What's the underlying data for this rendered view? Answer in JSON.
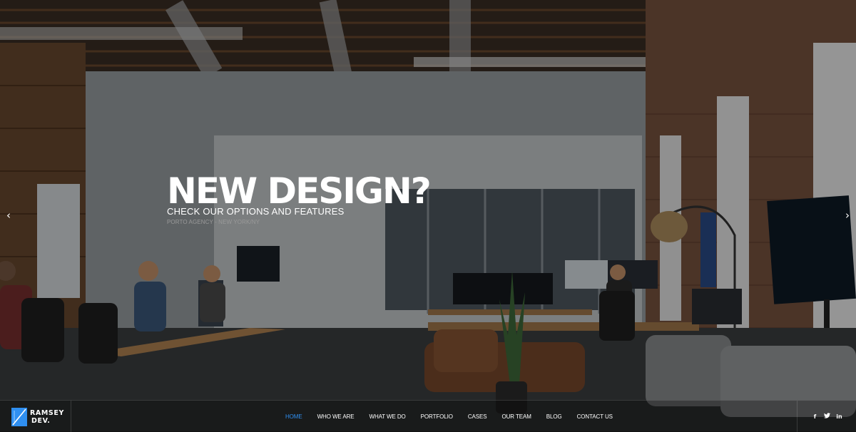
{
  "slide": {
    "title": "NEW DESIGN?",
    "subtitle": "CHECK OUR OPTIONS AND FEATURES",
    "tagline": "PORTO AGENCY - NEW YORK/NY"
  },
  "arrows": {
    "prev": "‹",
    "next": "›"
  },
  "logo": {
    "line1": "RAMSEY",
    "line2": "DEV."
  },
  "nav": {
    "items": [
      "HOME",
      "WHO WE ARE",
      "WHAT WE DO",
      "PORTFOLIO",
      "CASES",
      "OUR TEAM",
      "BLOG",
      "CONTACT US"
    ],
    "active_index": 0
  },
  "social": {
    "facebook": "f",
    "twitter": "🐦",
    "linkedin": "in"
  },
  "colors": {
    "accent": "#2f8ff0",
    "navbar_bg": "#000000",
    "text": "#ffffff",
    "muted": "#9a9a9a"
  }
}
